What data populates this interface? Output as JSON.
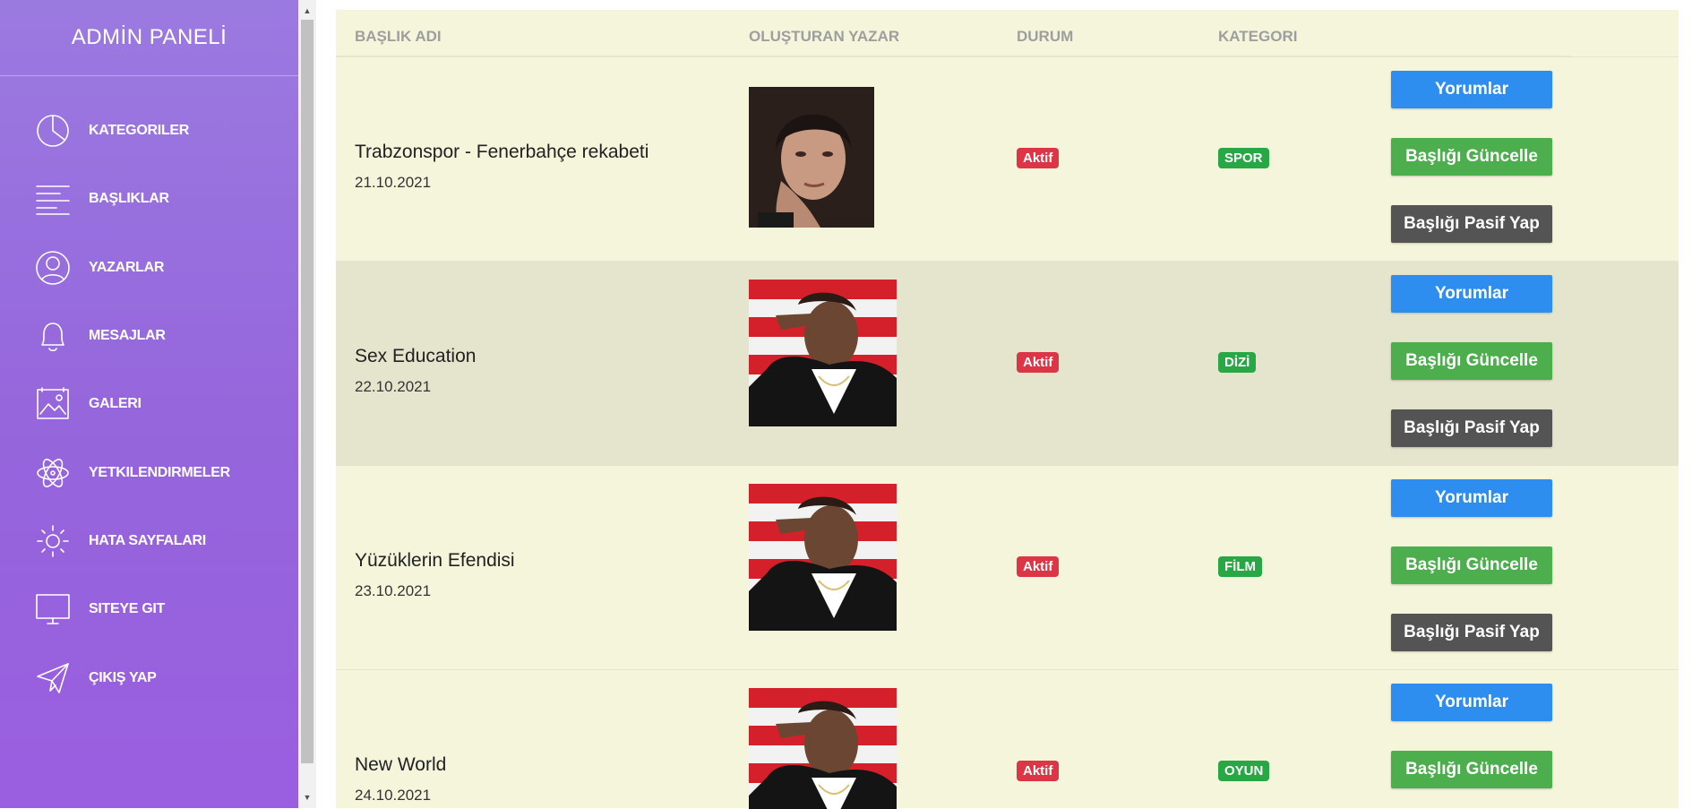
{
  "sidebar": {
    "brand": "ADMİN PANELİ",
    "items": [
      {
        "label": "KATEGORILER",
        "icon": "pie-chart-icon"
      },
      {
        "label": "BAŞLIKLAR",
        "icon": "lines-icon"
      },
      {
        "label": "YAZARLAR",
        "icon": "user-icon"
      },
      {
        "label": "MESAJLAR",
        "icon": "bell-icon"
      },
      {
        "label": "GALERI",
        "icon": "gallery-icon"
      },
      {
        "label": "YETKILENDIRMELER",
        "icon": "atom-icon"
      },
      {
        "label": "HATA SAYFALARI",
        "icon": "sun-icon"
      },
      {
        "label": "SITEYE GIT",
        "icon": "monitor-icon"
      },
      {
        "label": "ÇIKIŞ YAP",
        "icon": "paper-plane-icon"
      }
    ]
  },
  "table": {
    "headers": {
      "title": "BAŞLIK ADI",
      "author": "OLUŞTURAN YAZAR",
      "status": "DURUM",
      "category": "KATEGORI"
    },
    "rows": [
      {
        "title": "Trabzonspor - Fenerbahçe rekabeti",
        "date": "21.10.2021",
        "author_avatar": "woman-portrait",
        "status": "Aktif",
        "category": "SPOR",
        "buttons": {
          "comments": "Yorumlar",
          "update": "Başlığı Güncelle",
          "deactivate": "Başlığı Pasif Yap"
        }
      },
      {
        "title": "Sex Education",
        "date": "22.10.2021",
        "author_avatar": "man-saluting-portrait",
        "status": "Aktif",
        "category": "DİZİ",
        "buttons": {
          "comments": "Yorumlar",
          "update": "Başlığı Güncelle",
          "deactivate": "Başlığı Pasif Yap"
        }
      },
      {
        "title": "Yüzüklerin Efendisi",
        "date": "23.10.2021",
        "author_avatar": "man-saluting-portrait",
        "status": "Aktif",
        "category": "FİLM",
        "buttons": {
          "comments": "Yorumlar",
          "update": "Başlığı Güncelle",
          "deactivate": "Başlığı Pasif Yap"
        }
      },
      {
        "title": "New World",
        "date": "24.10.2021",
        "author_avatar": "man-saluting-portrait",
        "status": "Aktif",
        "category": "OYUN",
        "buttons": {
          "comments": "Yorumlar",
          "update": "Başlığı Güncelle"
        }
      }
    ]
  },
  "colors": {
    "sidebar_gradient": [
      "#9b7ae0",
      "#9a5ee0"
    ],
    "content_bg": "#f5f5dc",
    "status_badge": "#dc3545",
    "category_badge": "#28a745",
    "btn_comments": "#2e8ef0",
    "btn_update": "#4cae4c",
    "btn_deactivate": "#545454"
  }
}
